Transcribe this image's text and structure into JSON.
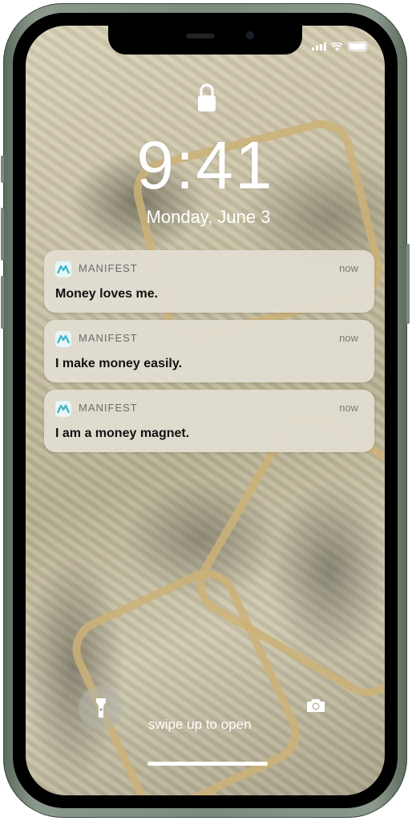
{
  "status_bar": {
    "icons": [
      "signal-icon",
      "wifi-icon",
      "battery-icon"
    ]
  },
  "lock_screen": {
    "time": "9:41",
    "date": "Monday, June 3"
  },
  "notifications": [
    {
      "app": "MANIFEST",
      "time": "now",
      "message": "Money loves me."
    },
    {
      "app": "MANIFEST",
      "time": "now",
      "message": "I make money easily."
    },
    {
      "app": "MANIFEST",
      "time": "now",
      "message": "I am a money magnet."
    }
  ],
  "bottom": {
    "swipe_hint": "swipe up to open",
    "left_icon": "flashlight-icon",
    "right_icon": "camera-icon"
  },
  "colors": {
    "app_icon_accent": "#45b8c4",
    "phone_frame": "#7b8a7c"
  }
}
